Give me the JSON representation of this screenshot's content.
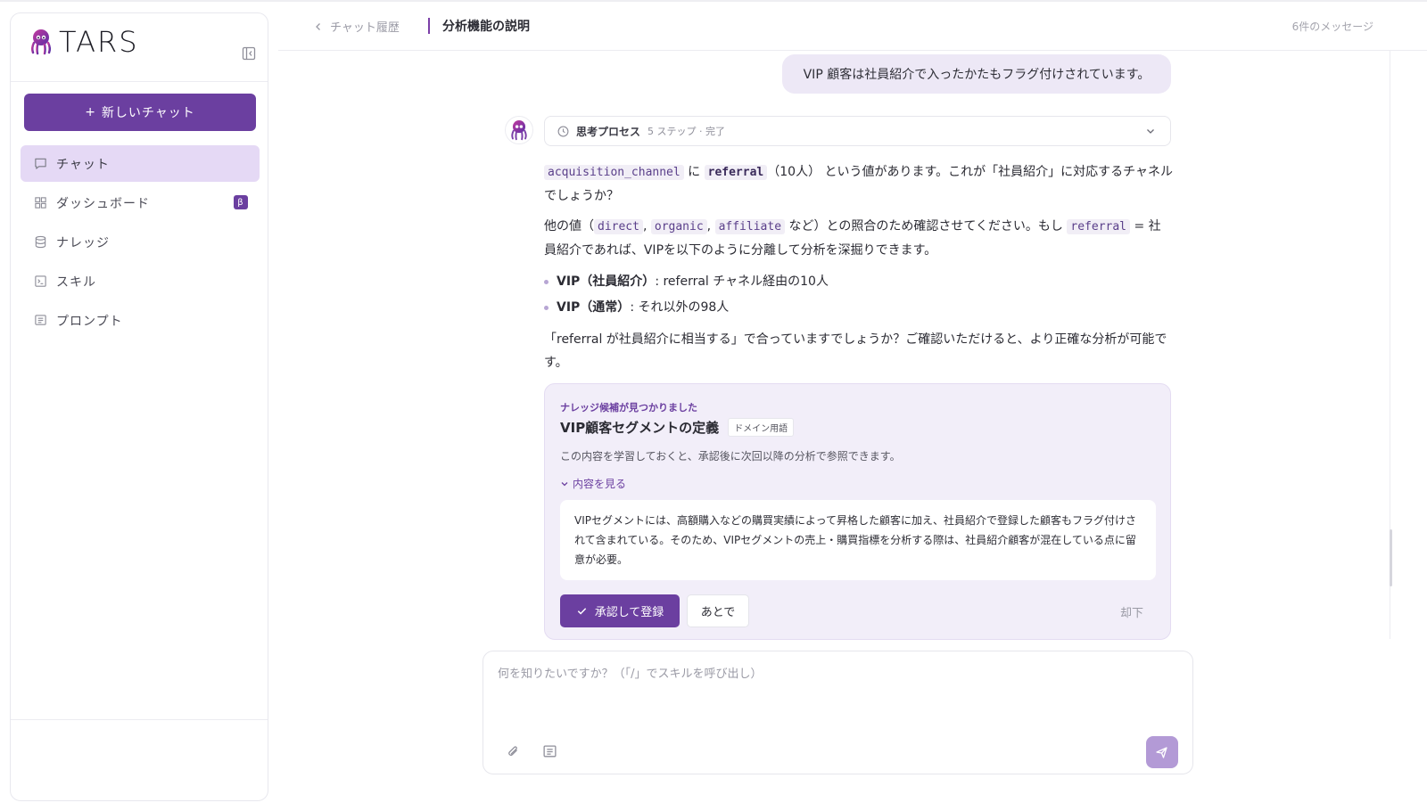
{
  "brand": {
    "name": "TARS"
  },
  "sidebar": {
    "new_chat_label": "新しいチャット",
    "items": [
      {
        "label": "チャット",
        "icon": "chat-icon",
        "active": true
      },
      {
        "label": "ダッシュボード",
        "icon": "dashboard-icon",
        "badge": "β"
      },
      {
        "label": "ナレッジ",
        "icon": "database-icon"
      },
      {
        "label": "スキル",
        "icon": "terminal-icon"
      },
      {
        "label": "プロンプト",
        "icon": "prompt-icon"
      }
    ]
  },
  "header": {
    "back_label": "チャット履歴",
    "title": "分析機能の説明",
    "message_count": "6件のメッセージ"
  },
  "chat": {
    "user_message": "VIP 顧客は社員紹介で入ったかたもフラグ付けされています。",
    "thinking": {
      "label": "思考プロセス",
      "steps": "5 ステップ · 完了"
    },
    "answer": {
      "p1_code1": "acquisition_channel",
      "p1_text1": "に",
      "p1_code2": "referral",
      "p1_text2": "（10人） という値があります。これが「社員紹介」に対応するチャネルでしょうか？",
      "p2_text1": "他の値（",
      "p2_code1": "direct",
      "p2_code2": "organic",
      "p2_code3": "affiliate",
      "p2_text2": "など）との照合のため確認させてください。もし",
      "p2_code4": "referral",
      "p2_text3": "= 社員紹介であれば、VIPを以下のように分離して分析を深掘りできます。",
      "bullets": [
        {
          "bold": "VIP（社員紹介）",
          "text": ": referral チャネル経由の10人"
        },
        {
          "bold": "VIP（通常）",
          "text": ": それ以外の98人"
        }
      ],
      "p3": "「referral が社員紹介に相当する」で合っていますでしょうか？ご確認いただけると、より正確な分析が可能です。"
    },
    "knowledge_card": {
      "eyebrow": "ナレッジ候補が見つかりました",
      "title": "VIP顧客セグメントの定義",
      "tag": "ドメイン用語",
      "description": "この内容を学習しておくと、承認後に次回以降の分析で参照できます。",
      "toggle_label": "内容を見る",
      "body": "VIPセグメントには、高額購入などの購買実績によって昇格した顧客に加え、社員紹介で登録した顧客もフラグ付けされて含まれている。そのため、VIPセグメントの売上・購買指標を分析する際は、社員紹介顧客が混在している点に留意が必要。",
      "approve_label": "承認して登録",
      "later_label": "あとで",
      "reject_label": "却下"
    }
  },
  "composer": {
    "placeholder": "何を知りたいですか？（「/」でスキルを呼び出し）",
    "value": ""
  },
  "colors": {
    "accent": "#6b3fa0",
    "active_nav": "#e5d9f5",
    "card_bg": "#f2eef9",
    "send_disabled": "#b39ad6"
  }
}
